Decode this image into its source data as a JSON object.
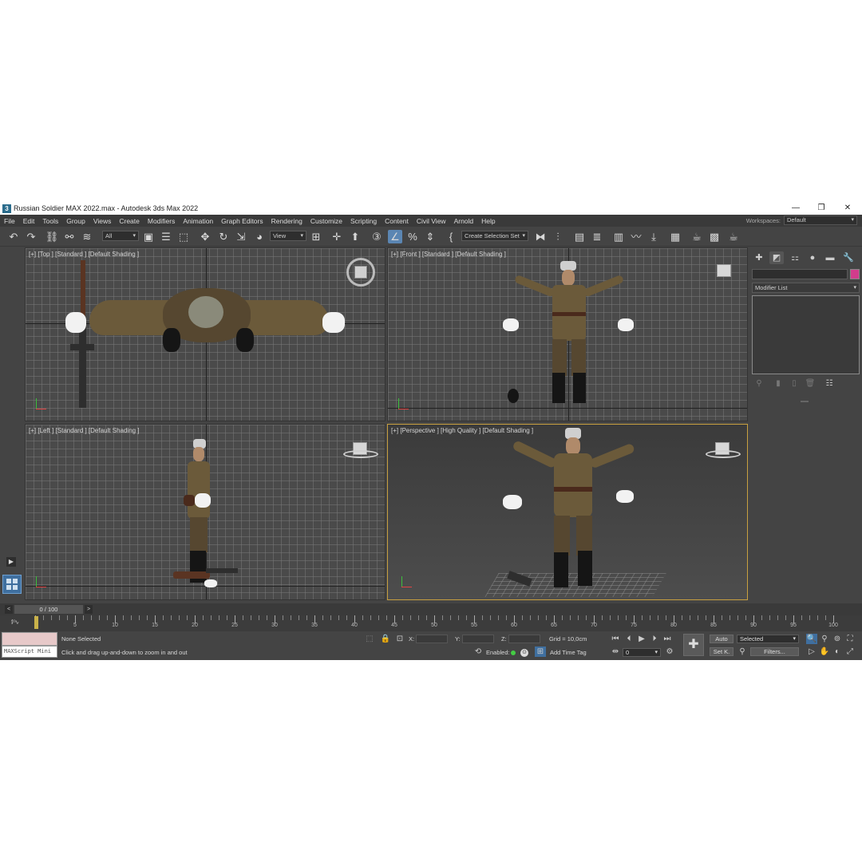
{
  "window": {
    "title": "Russian Soldier MAX 2022.max - Autodesk 3ds Max 2022",
    "app_icon_glyph": "3",
    "minimize_glyph": "—",
    "restore_glyph": "❐",
    "close_glyph": "✕"
  },
  "menu": {
    "items": [
      "File",
      "Edit",
      "Tools",
      "Group",
      "Views",
      "Create",
      "Modifiers",
      "Animation",
      "Graph Editors",
      "Rendering",
      "Customize",
      "Scripting",
      "Content",
      "Civil View",
      "Arnold",
      "Help"
    ],
    "workspaces_label": "Workspaces:",
    "workspaces_value": "Default"
  },
  "toolbar": {
    "selection_filter": "All",
    "ref_coord": "View",
    "selection_set": "Create Selection Set"
  },
  "viewports": {
    "top": {
      "label": "[+] [Top ] [Standard ] [Default Shading ]"
    },
    "front": {
      "label": "[+] [Front ] [Standard ] [Default Shading ]"
    },
    "left": {
      "label": "[+] [Left ] [Standard ] [Default Shading ]"
    },
    "perspective": {
      "label": "[+] [Perspective ] [High Quality ] [Default Shading ]"
    }
  },
  "command_panel": {
    "modifier_list": "Modifier List",
    "object_color": "#d23c8c"
  },
  "timeline": {
    "frame_display": "0 / 100",
    "prev_glyph": "<",
    "next_glyph": ">",
    "ticks": [
      "5",
      "10",
      "15",
      "20",
      "25",
      "30",
      "35",
      "40",
      "45",
      "50",
      "55",
      "60",
      "65",
      "70",
      "75",
      "80",
      "85",
      "90",
      "95",
      "100"
    ]
  },
  "status": {
    "maxscript_label": "MAXScript Mini",
    "selection_info": "None Selected",
    "prompt": "Click and drag up-and-down to zoom in and out",
    "x_label": "X:",
    "y_label": "Y:",
    "z_label": "Z:",
    "grid": "Grid = 10,0cm",
    "enabled_label": "Enabled:",
    "add_time_tag": "Add Time Tag",
    "auto_key": "Auto",
    "set_key": "Set K.",
    "key_filter": "Selected",
    "filters": "Filters...",
    "current_frame": "0"
  }
}
